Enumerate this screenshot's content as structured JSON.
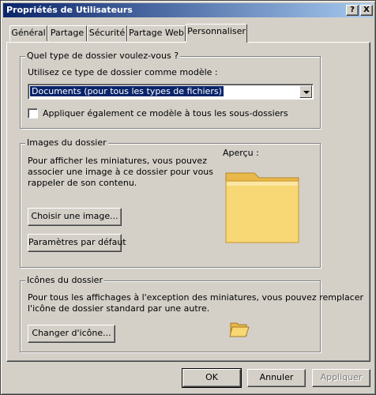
{
  "window": {
    "title": "Propriétés de Utilisateurs",
    "help_button": "?",
    "close_button": "X"
  },
  "tabs": [
    {
      "label": "Général",
      "active": false
    },
    {
      "label": "Partage",
      "active": false
    },
    {
      "label": "Sécurité",
      "active": false
    },
    {
      "label": "Partage Web",
      "active": false
    },
    {
      "label": "Personnaliser",
      "active": true
    }
  ],
  "folder_type": {
    "legend": "Quel type de dossier voulez-vous ?",
    "template_label": "Utilisez ce type de dossier comme modèle :",
    "template_value": "Documents (pour tous les types de fichiers)",
    "apply_all_label": "Appliquer également ce modèle à tous les sous-dossiers",
    "apply_all_checked": false
  },
  "folder_images": {
    "legend": "Images du dossier",
    "description_lines": [
      "Pour afficher les miniatures, vous pouvez",
      "associer une image à ce dossier pour vous",
      "rappeler de son contenu."
    ],
    "preview_label": "Aperçu :",
    "choose_image_button": "Choisir une image...",
    "restore_default_button": "Paramètres par défaut"
  },
  "folder_icons": {
    "legend": "Icônes du dossier",
    "description_lines": [
      "Pour tous les affichages à l'exception des miniatures, vous pouvez remplacer",
      "l'icône de dossier standard par une autre."
    ],
    "change_icon_button": "Changer d'icône..."
  },
  "footer": {
    "ok_button": "OK",
    "cancel_button": "Annuler",
    "apply_button": "Appliquer",
    "apply_enabled": false
  },
  "icons": {
    "preview_folder": "folder-icon",
    "small_folder": "folder-icon"
  },
  "colors": {
    "title_bar_start": "#0a246a",
    "title_bar_end": "#a6caf0",
    "selection": "#0a246a",
    "dialog_face": "#d4d0c8",
    "folder_fill": "#f8d775"
  }
}
